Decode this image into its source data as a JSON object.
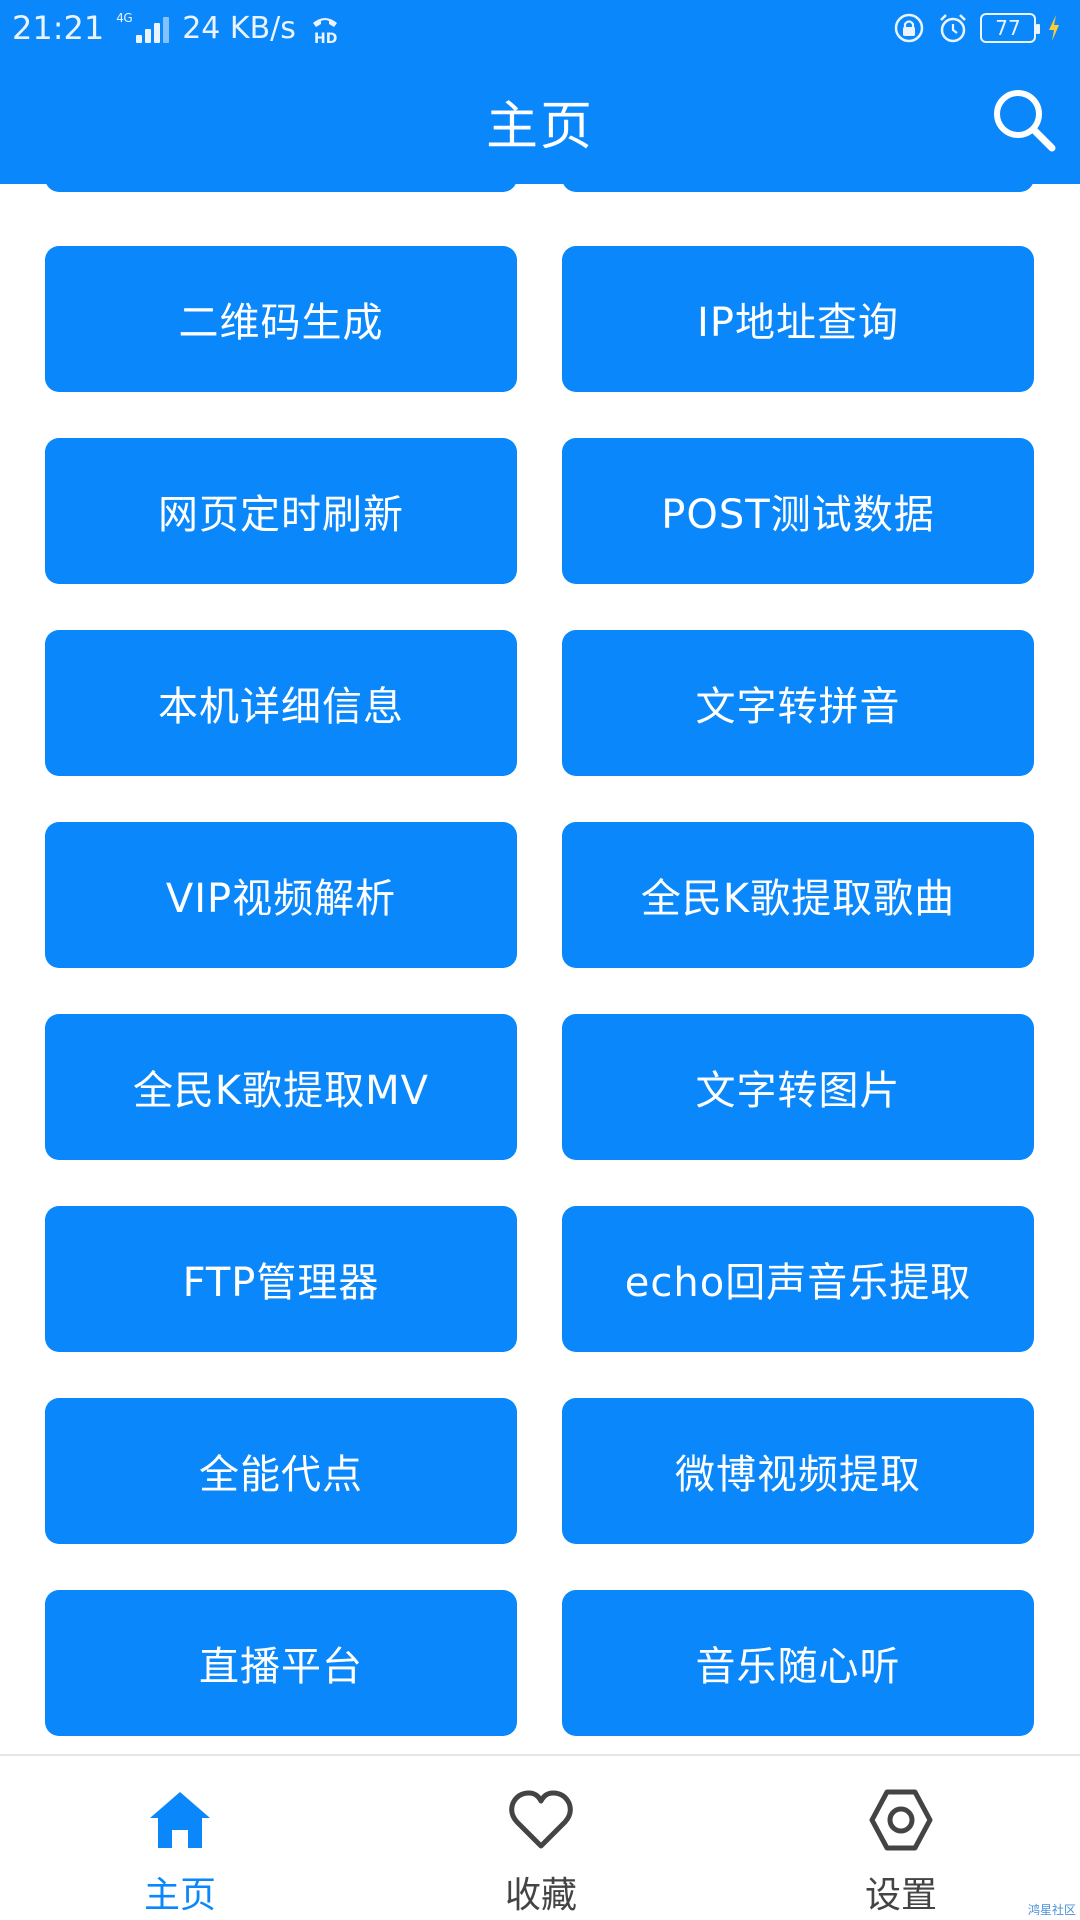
{
  "status_bar": {
    "time": "21:21",
    "network": "4G",
    "speed": "24 KB/s",
    "battery": "77"
  },
  "app_bar": {
    "title": "主页",
    "search_icon": "search-icon"
  },
  "tools": [
    {
      "label": ""
    },
    {
      "label": ""
    },
    {
      "label": "二维码生成"
    },
    {
      "label": "IP地址查询"
    },
    {
      "label": "网页定时刷新"
    },
    {
      "label": "POST测试数据"
    },
    {
      "label": "本机详细信息"
    },
    {
      "label": "文字转拼音"
    },
    {
      "label": "VIP视频解析"
    },
    {
      "label": "全民K歌提取歌曲"
    },
    {
      "label": "全民K歌提取MV"
    },
    {
      "label": "文字转图片"
    },
    {
      "label": "FTP管理器"
    },
    {
      "label": "echo回声音乐提取"
    },
    {
      "label": "全能代点"
    },
    {
      "label": "微博视频提取"
    },
    {
      "label": "直播平台"
    },
    {
      "label": "音乐随心听"
    }
  ],
  "bottom_nav": {
    "items": [
      {
        "label": "主页",
        "icon": "home-icon",
        "active": true
      },
      {
        "label": "收藏",
        "icon": "heart-icon",
        "active": false
      },
      {
        "label": "设置",
        "icon": "settings-icon",
        "active": false
      }
    ]
  },
  "watermark": "鸿星社区",
  "colors": {
    "accent": "#0a87fb",
    "background": "#ffffff",
    "inactive": "#444444"
  }
}
